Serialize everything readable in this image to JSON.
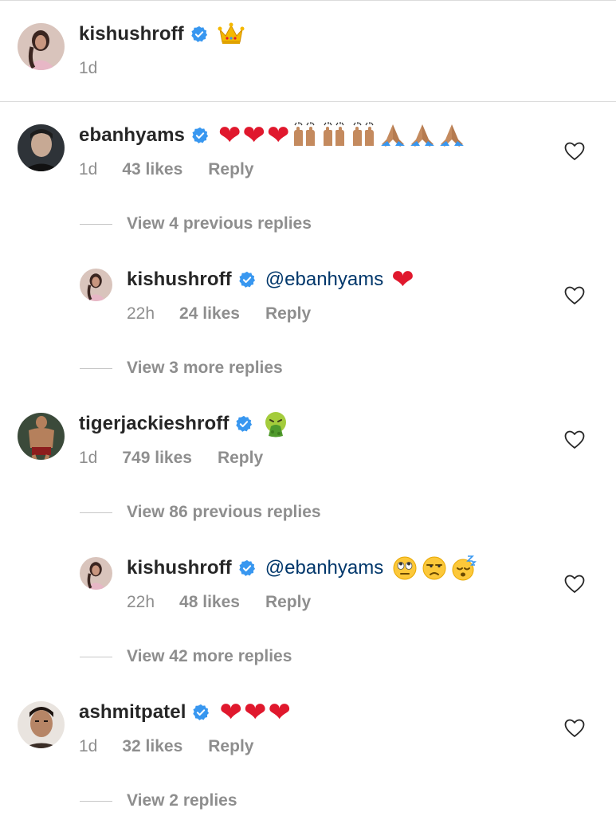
{
  "caption": {
    "username": "kishushroff",
    "emoji": "👑",
    "time": "1d"
  },
  "comments": [
    {
      "username": "ebanhyams",
      "emoji": [
        "❤",
        "❤",
        "❤",
        "🙌",
        "🙌",
        "🙌",
        "🙏",
        "🙏",
        "🙏"
      ],
      "time": "1d",
      "likes": "43 likes",
      "reply": "Reply",
      "view_replies": "View 4 previous replies"
    },
    {
      "username": "kishushroff",
      "mention": "@ebanhyams",
      "emoji": [
        "❤"
      ],
      "time": "22h",
      "likes": "24 likes",
      "reply": "Reply",
      "view_replies": "View 3 more replies"
    },
    {
      "username": "tigerjackieshroff",
      "emoji": [
        "🤮"
      ],
      "time": "1d",
      "likes": "749 likes",
      "reply": "Reply",
      "view_replies": "View 86 previous replies"
    },
    {
      "username": "kishushroff",
      "mention": "@ebanhyams",
      "emoji": [
        "🙄",
        "😒",
        "😴"
      ],
      "time": "22h",
      "likes": "48 likes",
      "reply": "Reply",
      "view_replies": "View 42 more replies"
    },
    {
      "username": "ashmitpatel",
      "emoji": [
        "❤",
        "❤",
        "❤"
      ],
      "time": "1d",
      "likes": "32 likes",
      "reply": "Reply",
      "view_replies": "View 2 replies"
    }
  ],
  "icons": {
    "verified": "verified-badge-icon",
    "like": "heart-outline-icon"
  },
  "colors": {
    "username": "#262626",
    "meta": "#8e8e8e",
    "mention": "#00376b",
    "verified": "#3897f0",
    "heart_emoji": "#e0182d",
    "divider": "#dbdbdb"
  }
}
